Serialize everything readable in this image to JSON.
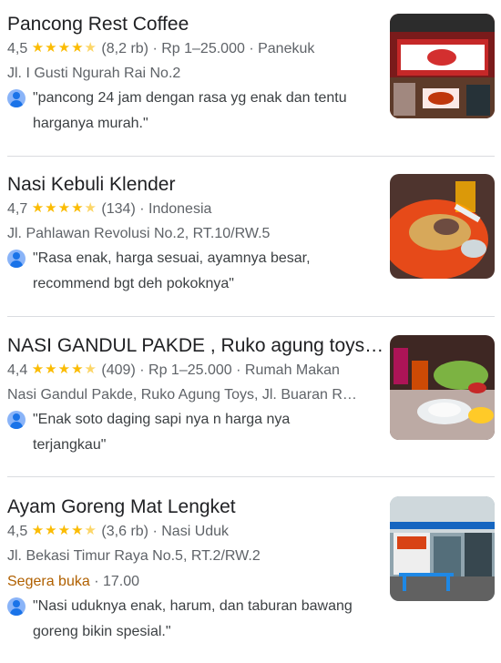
{
  "results": [
    {
      "name": "Pancong Rest Coffee",
      "rating": "4,5",
      "reviews": "(8,2 rb)",
      "price": "Rp 1–25.000",
      "category": "Panekuk",
      "address": "Jl. I Gusti Ngurah Rai No.2",
      "review_line1": "\"pancong 24 jam dengan rasa yg enak dan tentu",
      "review_line2": "harganya murah.\""
    },
    {
      "name": "Nasi Kebuli Klender",
      "rating": "4,7",
      "reviews": "(134)",
      "category": "Indonesia",
      "address": "Jl. Pahlawan Revolusi No.2, RT.10/RW.5",
      "review_line1": "\"Rasa enak, harga sesuai, ayamnya besar,",
      "review_line2": "recommend bgt deh pokoknya\""
    },
    {
      "name": "NASI GANDUL PAKDE , Ruko agung toys…",
      "rating": "4,4",
      "reviews": "(409)",
      "price": "Rp 1–25.000",
      "category": "Rumah Makan",
      "address": "Nasi Gandul Pakde, Ruko Agung Toys, Jl. Buaran R…",
      "review_line1": "\"Enak soto daging sapi nya n harga nya",
      "review_line2": "terjangkau\""
    },
    {
      "name": "Ayam Goreng Mat Lengket",
      "rating": "4,5",
      "reviews": "(3,6 rb)",
      "category": "Nasi Uduk",
      "address": "Jl. Bekasi Timur Raya No.5, RT.2/RW.2",
      "status_open": "Segera buka",
      "status_time": "17.00",
      "review_line1": "\"Nasi uduknya enak, harum, dan taburan bawang",
      "review_line2": "goreng bikin spesial.\""
    }
  ],
  "separator": "·",
  "star_glyph": "★",
  "colors": {
    "star": "#fbbc04",
    "open_soon": "#b06000",
    "avatar": "#1a73e8"
  }
}
